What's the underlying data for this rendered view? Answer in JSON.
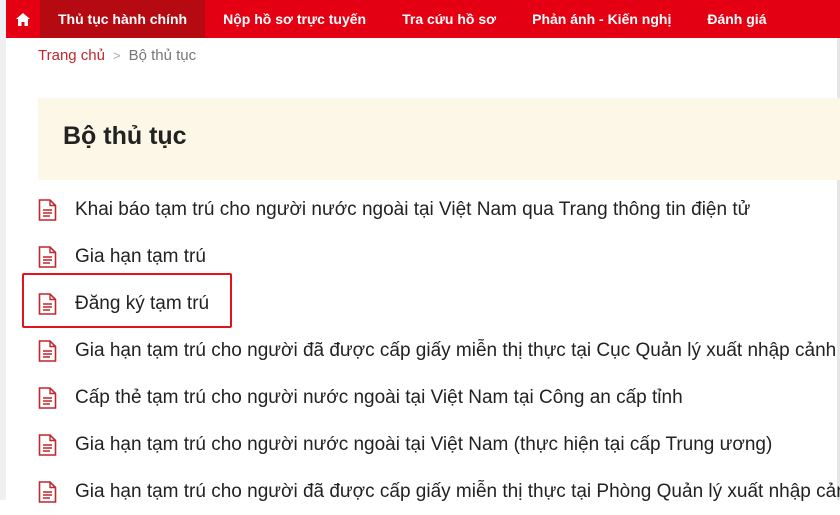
{
  "nav": {
    "home_icon": "home-icon",
    "items": [
      {
        "label": "Thủ tục hành chính",
        "active": true
      },
      {
        "label": "Nộp hồ sơ trực tuyến",
        "active": false
      },
      {
        "label": "Tra cứu hồ sơ",
        "active": false
      },
      {
        "label": "Phản ánh - Kiến nghị",
        "active": false
      },
      {
        "label": "Đánh giá",
        "active": false
      }
    ]
  },
  "breadcrumb": {
    "home": "Trang chủ",
    "separator": ">",
    "current": "Bộ thủ tục"
  },
  "page_title": "Bộ thủ tục",
  "procedures": [
    {
      "label": "Khai báo tạm trú cho người nước ngoài tại Việt Nam qua Trang thông tin điện tử"
    },
    {
      "label": "Gia hạn tạm trú"
    },
    {
      "label": "Đăng ký tạm trú"
    },
    {
      "label": "Gia hạn tạm trú cho người đã được cấp giấy miễn thị thực tại Cục Quản lý xuất nhập cảnh Bộ"
    },
    {
      "label": "Cấp thẻ tạm trú cho người nước ngoài tại Việt Nam tại Công an cấp tỉnh"
    },
    {
      "label": "Gia hạn tạm trú cho người nước ngoài tại Việt Nam (thực hiện tại cấp Trung ương)"
    },
    {
      "label": "Gia hạn tạm trú cho người đã được cấp giấy miễn thị thực tại Phòng Quản lý xuất nhập cảnh"
    }
  ],
  "colors": {
    "nav_bg": "#e40012",
    "nav_active": "#b50a12",
    "accent": "#c1272d",
    "title_bg": "#fdf7e7",
    "highlight": "#e3131c"
  }
}
